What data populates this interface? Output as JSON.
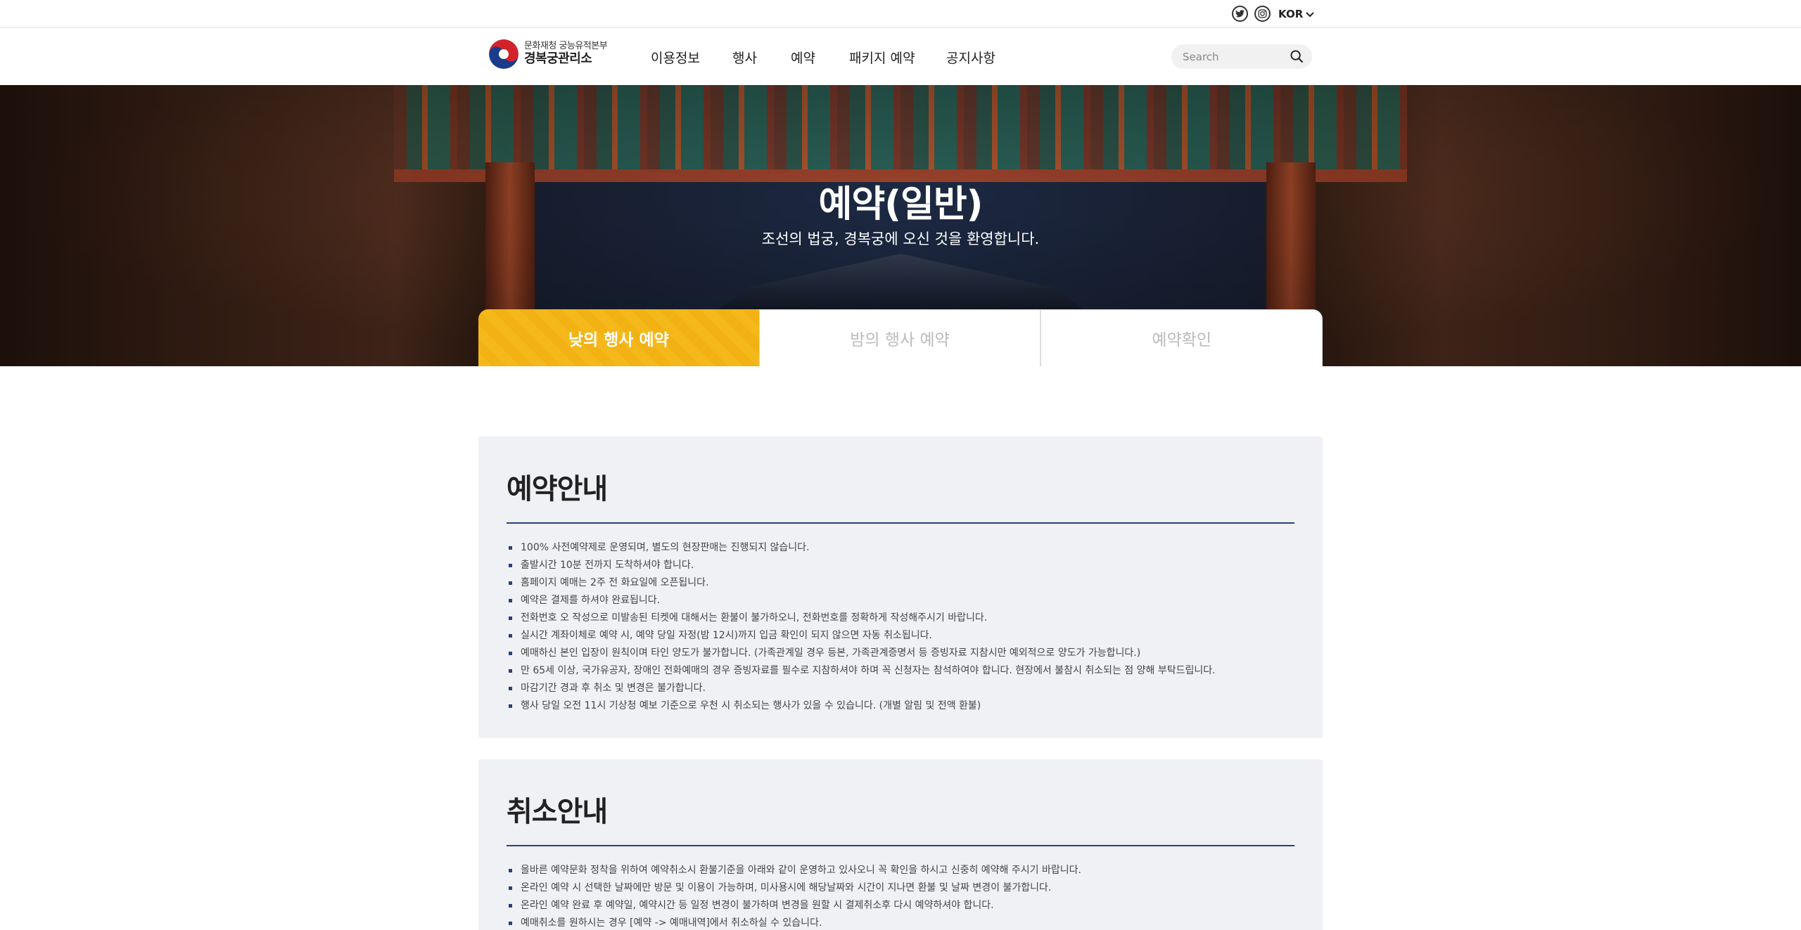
{
  "utility": {
    "language": "KOR",
    "icons": [
      "twitter-icon",
      "instagram-icon",
      "chevron-down-icon"
    ]
  },
  "header": {
    "logo_sub": "문화재청 궁능유적본부",
    "logo_main": "경복궁관리소",
    "nav": [
      "이용정보",
      "행사",
      "예약",
      "패키지 예약",
      "공지사항"
    ],
    "search_placeholder": "Search",
    "search_icon": "search-icon"
  },
  "hero": {
    "title": "예약(일반)",
    "subtitle": "조선의 법궁, 경복궁에 오신 것을 환영합니다."
  },
  "tabs": [
    {
      "label": "낮의 행사 예약",
      "active": true
    },
    {
      "label": "밤의 행사 예약",
      "active": false
    },
    {
      "label": "예약확인",
      "active": false
    }
  ],
  "reservation_info": {
    "title": "예약안내",
    "items": [
      "100% 사전예약제로 운영되며, 별도의 현장판매는 진행되지 않습니다.",
      "출발시간 10분 전까지 도착하셔야 합니다.",
      "홈페이지 예매는 2주 전 화요일에 오픈됩니다.",
      "예약은 결제를 하셔야 완료됩니다.",
      "전화번호 오 작성으로 미발송된 티켓에 대해서는 환불이 불가하오니, 전화번호를 정확하게 작성해주시기 바랍니다.",
      "실시간 계좌이체로 예약 시, 예약 당일 자정(밤 12시)까지 입금 확인이 되지 않으면 자동 취소됩니다.",
      "예매하신 본인 입장이 원칙이며 타인 양도가 불가합니다. (가족관계일 경우 등본, 가족관계증명서 등 증빙자료 지참시만 예외적으로 양도가 가능합니다.)",
      "만 65세 이상, 국가유공자, 장애인 전화예매의 경우 증빙자료를 필수로 지참하셔야 하며 꼭 신청자는 참석하여야 합니다. 현장에서 불참시 취소되는 점 양해 부탁드립니다.",
      "마감기간 경과 후 취소 및 변경은 불가합니다.",
      "행사 당일 오전 11시 기상청 예보 기준으로 우천 시 취소되는 행사가 있을 수 있습니다. (개별 알림 및 전액 환불)"
    ]
  },
  "cancel_info": {
    "title": "취소안내",
    "items": [
      "올바른 예약문화 정착을 위하여 예약취소시 환불기준을 아래와 같이 운영하고 있사오니 꼭 확인을 하시고 신중히 예약해 주시기 바랍니다.",
      "온라인 예약 시 선택한 날짜에만 방문 및 이용이 가능하며, 미사용시에 해당날짜와 시간이 지나면 환불 및 날짜 변경이 불가합니다.",
      "온라인 예약 완료 후 예약일, 예약시간 등 일정 변경이 불가하며 변경을 원할 시 결제취소후 다시 예약하셔야 합니다.",
      "예매취소를 원하시는 경우 [예약 -> 예매내역]에서 취소하실 수 있습니다."
    ]
  },
  "colors": {
    "accent_yellow": "#f5b81b",
    "navy_rule": "#2b3f7f",
    "box_bg": "#f0f1f5"
  }
}
